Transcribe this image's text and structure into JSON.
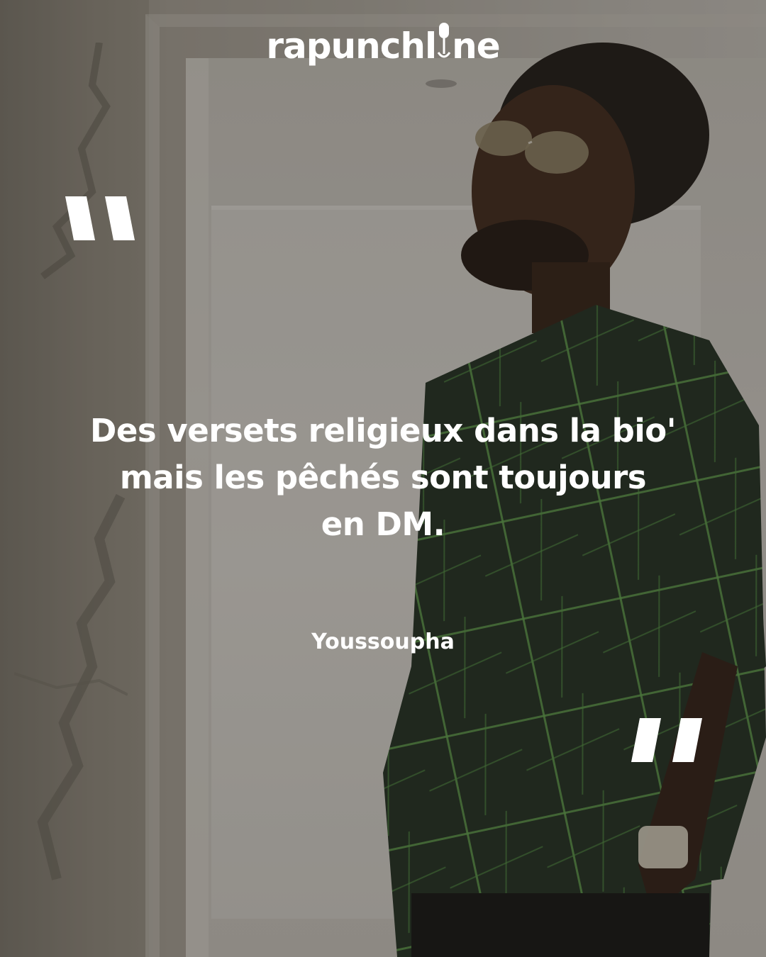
{
  "brand": {
    "logo_left": "rapunchl",
    "logo_right": "ne",
    "logo_mic_icon": "microphone-icon"
  },
  "quote": {
    "open_mark_icon": "open-quote-icon",
    "close_mark_icon": "close-quote-icon",
    "lines": [
      "Des versets religieux dans la bio'",
      "mais les pêchés sont toujours",
      "en DM."
    ],
    "author": "Youssoupha"
  },
  "colors": {
    "text": "#ffffff",
    "shirt_green": "#1f3a24",
    "shirt_stripe": "#5f9c4a"
  }
}
